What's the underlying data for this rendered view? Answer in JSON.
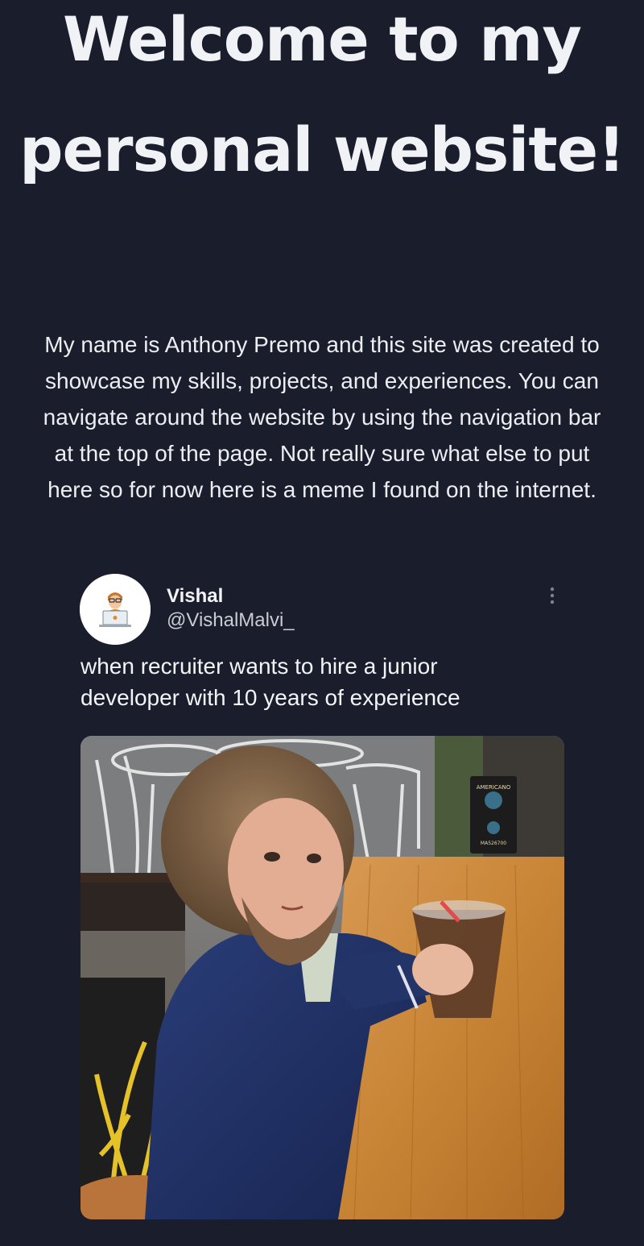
{
  "hero": {
    "title": "Welcome to my personal website!"
  },
  "intro": {
    "text": "My name is Anthony Premo and this site was created to showcase my skills, projects, and experiences. You can navigate around the website by using the navigation bar at the top of the page. Not really sure what else to put here so for now here is a meme I found on the internet."
  },
  "tweet": {
    "author_name": "Vishal",
    "author_handle": "@VishalMalvi_",
    "text": "when recruiter wants to hire a junior developer with 10 years of experience",
    "more_icon": "more-vertical-icon",
    "media": {
      "sign_text": [
        "AMERICANO",
        "MA526700"
      ]
    }
  },
  "colors": {
    "page_background": "#191d2c",
    "text_primary": "#f3f4f6",
    "text_secondary": "#c9ccd3"
  }
}
